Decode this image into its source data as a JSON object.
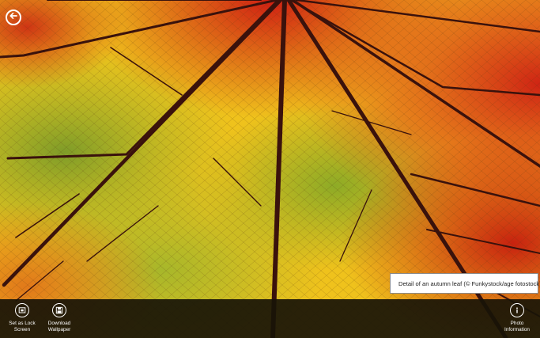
{
  "photo": {
    "subject": "autumn-leaf-veins-photo",
    "colors": {
      "red": "#d8301a",
      "orange": "#ee8a1a",
      "yellow": "#f2d21c",
      "green": "#9ab82a",
      "vein": "#3a120c"
    }
  },
  "nav": {
    "back_icon": "back-arrow-icon"
  },
  "caption": {
    "text": "Detail of an autumn leaf (© Funkystock/age fotostock)"
  },
  "appbar": {
    "set_lock_screen": {
      "label": "Set as Lock\nScreen",
      "icon": "lock-screen-icon"
    },
    "download_wallpaper": {
      "label": "Download\nWallpaper",
      "icon": "download-icon"
    },
    "photo_information": {
      "label": "Photo\nInformation",
      "icon": "info-icon"
    }
  }
}
